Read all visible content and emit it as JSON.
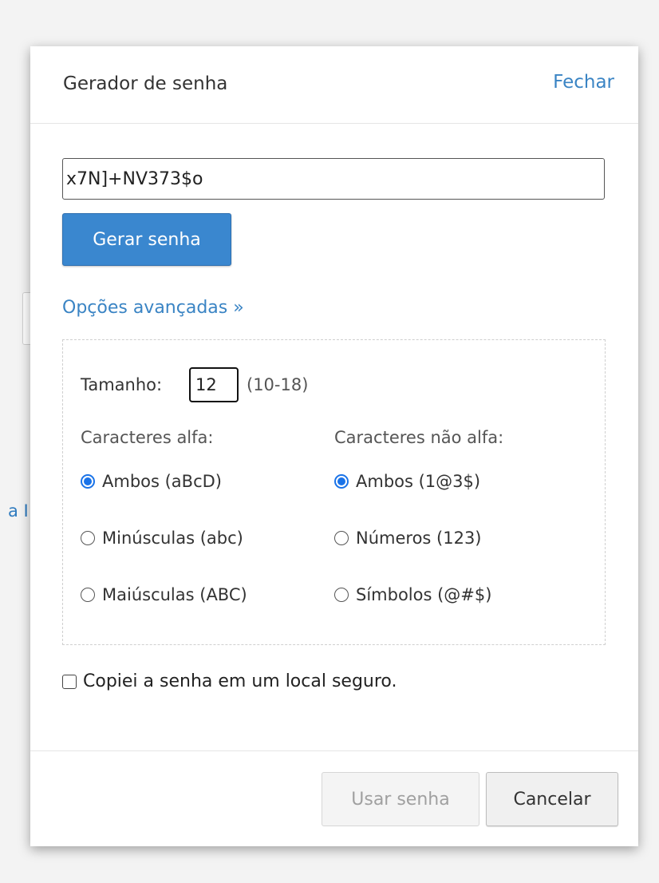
{
  "background": {
    "partial_text": "a I"
  },
  "dialog": {
    "title": "Gerador de senha",
    "close_label": "Fechar",
    "password_value": "x7N]+NV373$o",
    "generate_label": "Gerar senha",
    "advanced_label": "Opções avançadas »",
    "advanced": {
      "size_label": "Tamanho:",
      "size_value": "12",
      "size_range": "(10-18)",
      "alpha_heading": "Caracteres alfa:",
      "nonalpha_heading": "Caracteres não alfa:",
      "alpha_options": [
        {
          "label": "Ambos (aBcD)",
          "checked": true
        },
        {
          "label": "Minúsculas (abc)",
          "checked": false
        },
        {
          "label": "Maiúsculas (ABC)",
          "checked": false
        }
      ],
      "nonalpha_options": [
        {
          "label": "Ambos (1@3$)",
          "checked": true
        },
        {
          "label": "Números (123)",
          "checked": false
        },
        {
          "label": "Símbolos (@#$)",
          "checked": false
        }
      ]
    },
    "confirm_label": "Copiei a senha em um local seguro.",
    "confirm_checked": false,
    "use_label": "Usar senha",
    "cancel_label": "Cancelar"
  },
  "colors": {
    "accent": "#3a87cf",
    "link": "#3a84c4",
    "radio_checked": "#1a73e8"
  }
}
